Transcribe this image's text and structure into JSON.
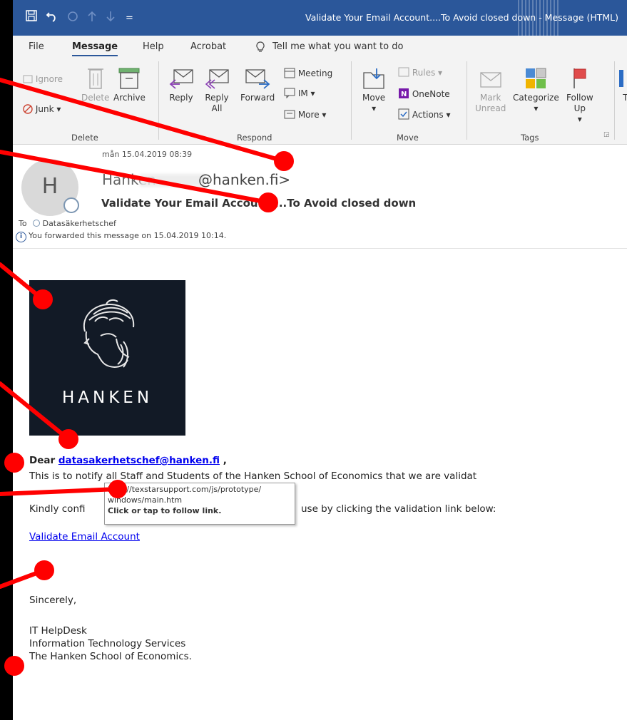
{
  "window": {
    "title": "Validate Your Email Account....To Avoid closed down  -  Message (HTML)"
  },
  "quick_access": {
    "save_icon": "save-icon",
    "undo_icon": "undo-icon",
    "redo_icon": "redo-icon",
    "up_icon": "arrow-up-icon",
    "down_icon": "arrow-down-icon",
    "customize_glyph": "="
  },
  "tabs": [
    {
      "label": "File"
    },
    {
      "label": "Message"
    },
    {
      "label": "Help"
    },
    {
      "label": "Acrobat"
    },
    {
      "label": "Tell me what you want to do"
    }
  ],
  "ribbon": {
    "delete": {
      "ignore": "Ignore",
      "junk": "Junk",
      "delete": "Delete",
      "archive": "Archive",
      "group": "Delete"
    },
    "respond": {
      "reply": "Reply",
      "reply_all_1": "Reply",
      "reply_all_2": "All",
      "forward": "Forward",
      "meeting": "Meeting",
      "im": "IM",
      "more": "More",
      "group": "Respond"
    },
    "move": {
      "move": "Move",
      "rules": "Rules",
      "onenote": "OneNote",
      "actions": "Actions",
      "group": "Move"
    },
    "tags": {
      "mark_1": "Mark",
      "mark_2": "Unread",
      "categorize": "Categorize",
      "follow_1": "Follow",
      "follow_2": "Up",
      "group": "Tags"
    },
    "translate_partial": "Tra"
  },
  "message": {
    "date": "mån 15.04.2019 08:39",
    "avatar_initial": "H",
    "sender_name": "Hanken",
    "sender_email_visible": "@hanken.fi>",
    "subject": "Validate Your Email Account....To Avoid closed down",
    "to_label": "To",
    "to_recipient": "Datasäkerhetschef",
    "forwarded_info": "You forwarded this message on 15.04.2019 10:14."
  },
  "body": {
    "logo_text": "HANKEN",
    "dear_prefix": "Dear",
    "dear_email": "datasakerhetschef@hanken.fi",
    "dear_suffix": ",",
    "para1": "This is to notify all Staff and Students of the Hanken School of Economics that we are validat",
    "para2_start": "Kindly confi",
    "para2_end": "use by clicking the validation link below:",
    "link_text": "Validate Email Account",
    "signoff": "Sincerely,",
    "sig_line1": "IT HelpDesk",
    "sig_line2": "Information Technology Services",
    "sig_line3": "The Hanken School of Economics."
  },
  "tooltip": {
    "line1": "http://texstarsupport.com/js/prototype/",
    "line2": "windows/main.htm",
    "line3": "Click or tap to follow link."
  },
  "colors": {
    "title_bar": "#2b579a",
    "annotation_red": "#ff0000",
    "link_blue": "#0000ee"
  }
}
